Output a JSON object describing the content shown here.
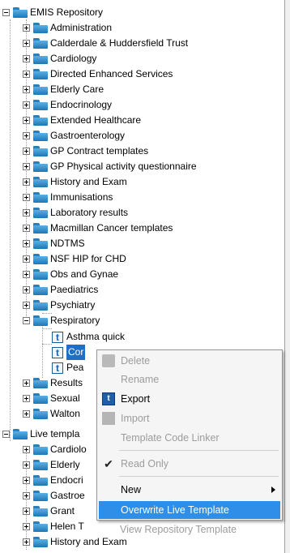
{
  "tree": {
    "root1": "EMIS Repository",
    "root1_children": [
      "Administration",
      "Calderdale & Huddersfield Trust",
      "Cardiology",
      "Directed Enhanced Services",
      "Elderly Care",
      "Endocrinology",
      "Extended Healthcare",
      "Gastroenterology",
      "GP Contract templates",
      "GP Physical activity questionnaire",
      "History and Exam",
      "Immunisations",
      "Laboratory results",
      "Macmillan Cancer templates",
      "NDTMS",
      "NSF HIP for CHD",
      "Obs and Gynae",
      "Paediatrics",
      "Psychiatry",
      "Respiratory"
    ],
    "respiratory_templates": [
      "Asthma quick",
      "Cor",
      "Pea"
    ],
    "after_respiratory": [
      "Results",
      "Sexual",
      "Walton"
    ],
    "root2": "Live templa",
    "root2_children": [
      "Cardiolo",
      "Elderly",
      "Endocri",
      "Gastroe",
      "Grant",
      "Helen T",
      "History and Exam"
    ]
  },
  "context_menu": {
    "delete": "Delete",
    "rename": "Rename",
    "export": "Export",
    "import": "Import",
    "template_code_linker": "Template Code Linker",
    "read_only": "Read Only",
    "read_only_checked": true,
    "new": "New",
    "overwrite_live_template": "Overwrite Live Template",
    "view_repository_template": "View Repository Template"
  },
  "icons": {
    "folder": "folder-icon",
    "template": "template-t-icon",
    "expand": "plus-box-icon",
    "collapse": "minus-box-icon",
    "submenu": "chevron-right-icon",
    "check": "checkmark-icon"
  },
  "colors": {
    "selection": "#2f8ee8",
    "folder": "#3a96d6",
    "disabled_text": "#9c9c9c"
  }
}
